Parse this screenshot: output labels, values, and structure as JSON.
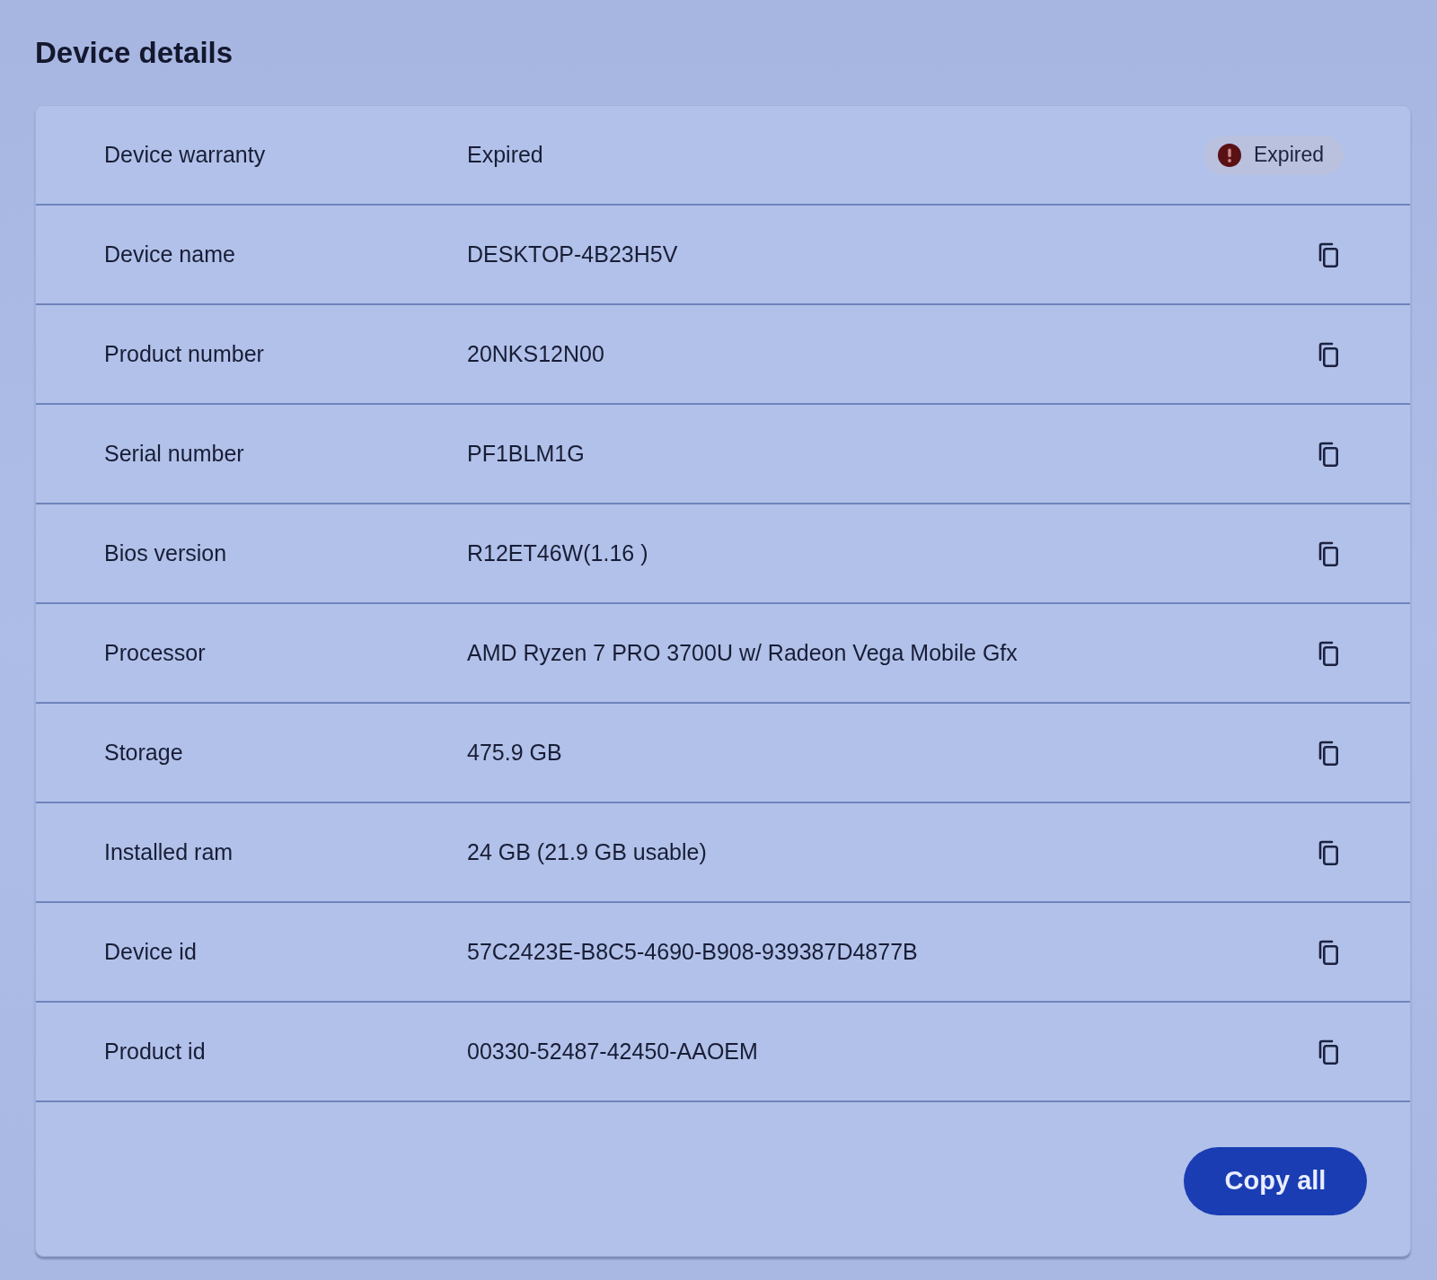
{
  "title": "Device details",
  "rows": [
    {
      "label": "Device warranty",
      "value": "Expired",
      "kind": "badge",
      "badge": {
        "label": "Expired"
      }
    },
    {
      "label": "Device name",
      "value": "DESKTOP-4B23H5V",
      "kind": "copy"
    },
    {
      "label": "Product number",
      "value": "20NKS12N00",
      "kind": "copy"
    },
    {
      "label": "Serial number",
      "value": "PF1BLM1G",
      "kind": "copy"
    },
    {
      "label": "Bios version",
      "value": "R12ET46W(1.16 )",
      "kind": "copy"
    },
    {
      "label": "Processor",
      "value": "AMD Ryzen 7 PRO 3700U w/ Radeon Vega Mobile Gfx",
      "kind": "copy"
    },
    {
      "label": "Storage",
      "value": "475.9 GB",
      "kind": "copy"
    },
    {
      "label": "Installed ram",
      "value": "24 GB (21.9 GB usable)",
      "kind": "copy"
    },
    {
      "label": "Device id",
      "value": "57C2423E-B8C5-4690-B908-939387D4877B",
      "kind": "copy"
    },
    {
      "label": "Product id",
      "value": "00330-52487-42450-AAOEM",
      "kind": "copy"
    }
  ],
  "footer": {
    "copy_all_button": "Copy all"
  }
}
